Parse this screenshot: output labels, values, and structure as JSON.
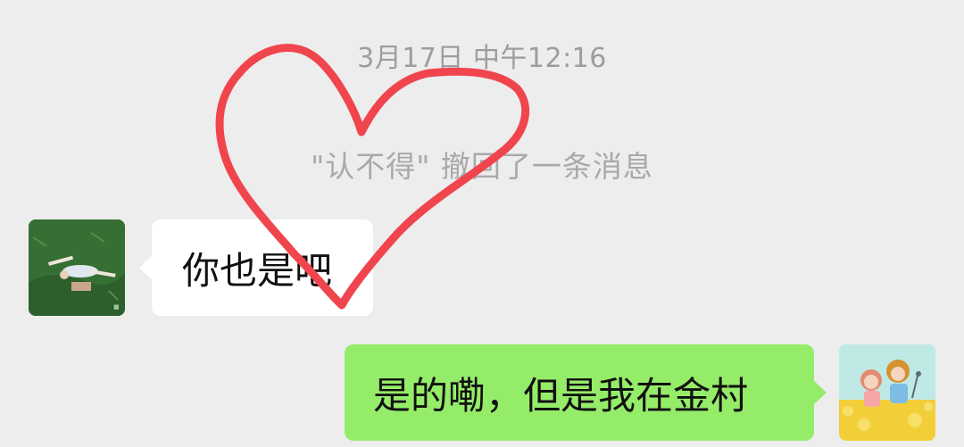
{
  "chat": {
    "timestamp": "3月17日  中午12:16",
    "recall_notice": "\"认不得\" 撤回了一条消息",
    "messages": [
      {
        "side": "left",
        "text": "你也是吧"
      },
      {
        "side": "right",
        "text": "是的嘞，但是我在金村"
      }
    ]
  },
  "colors": {
    "background": "#ededed",
    "bubble_left": "#ffffff",
    "bubble_right": "#95ec69",
    "heart_stroke": "#f0454d"
  },
  "icons": {
    "left_avatar": "avatar-girl-on-grass",
    "right_avatar": "avatar-cartoon-kids-flowers",
    "overlay": "heart-doodle"
  }
}
